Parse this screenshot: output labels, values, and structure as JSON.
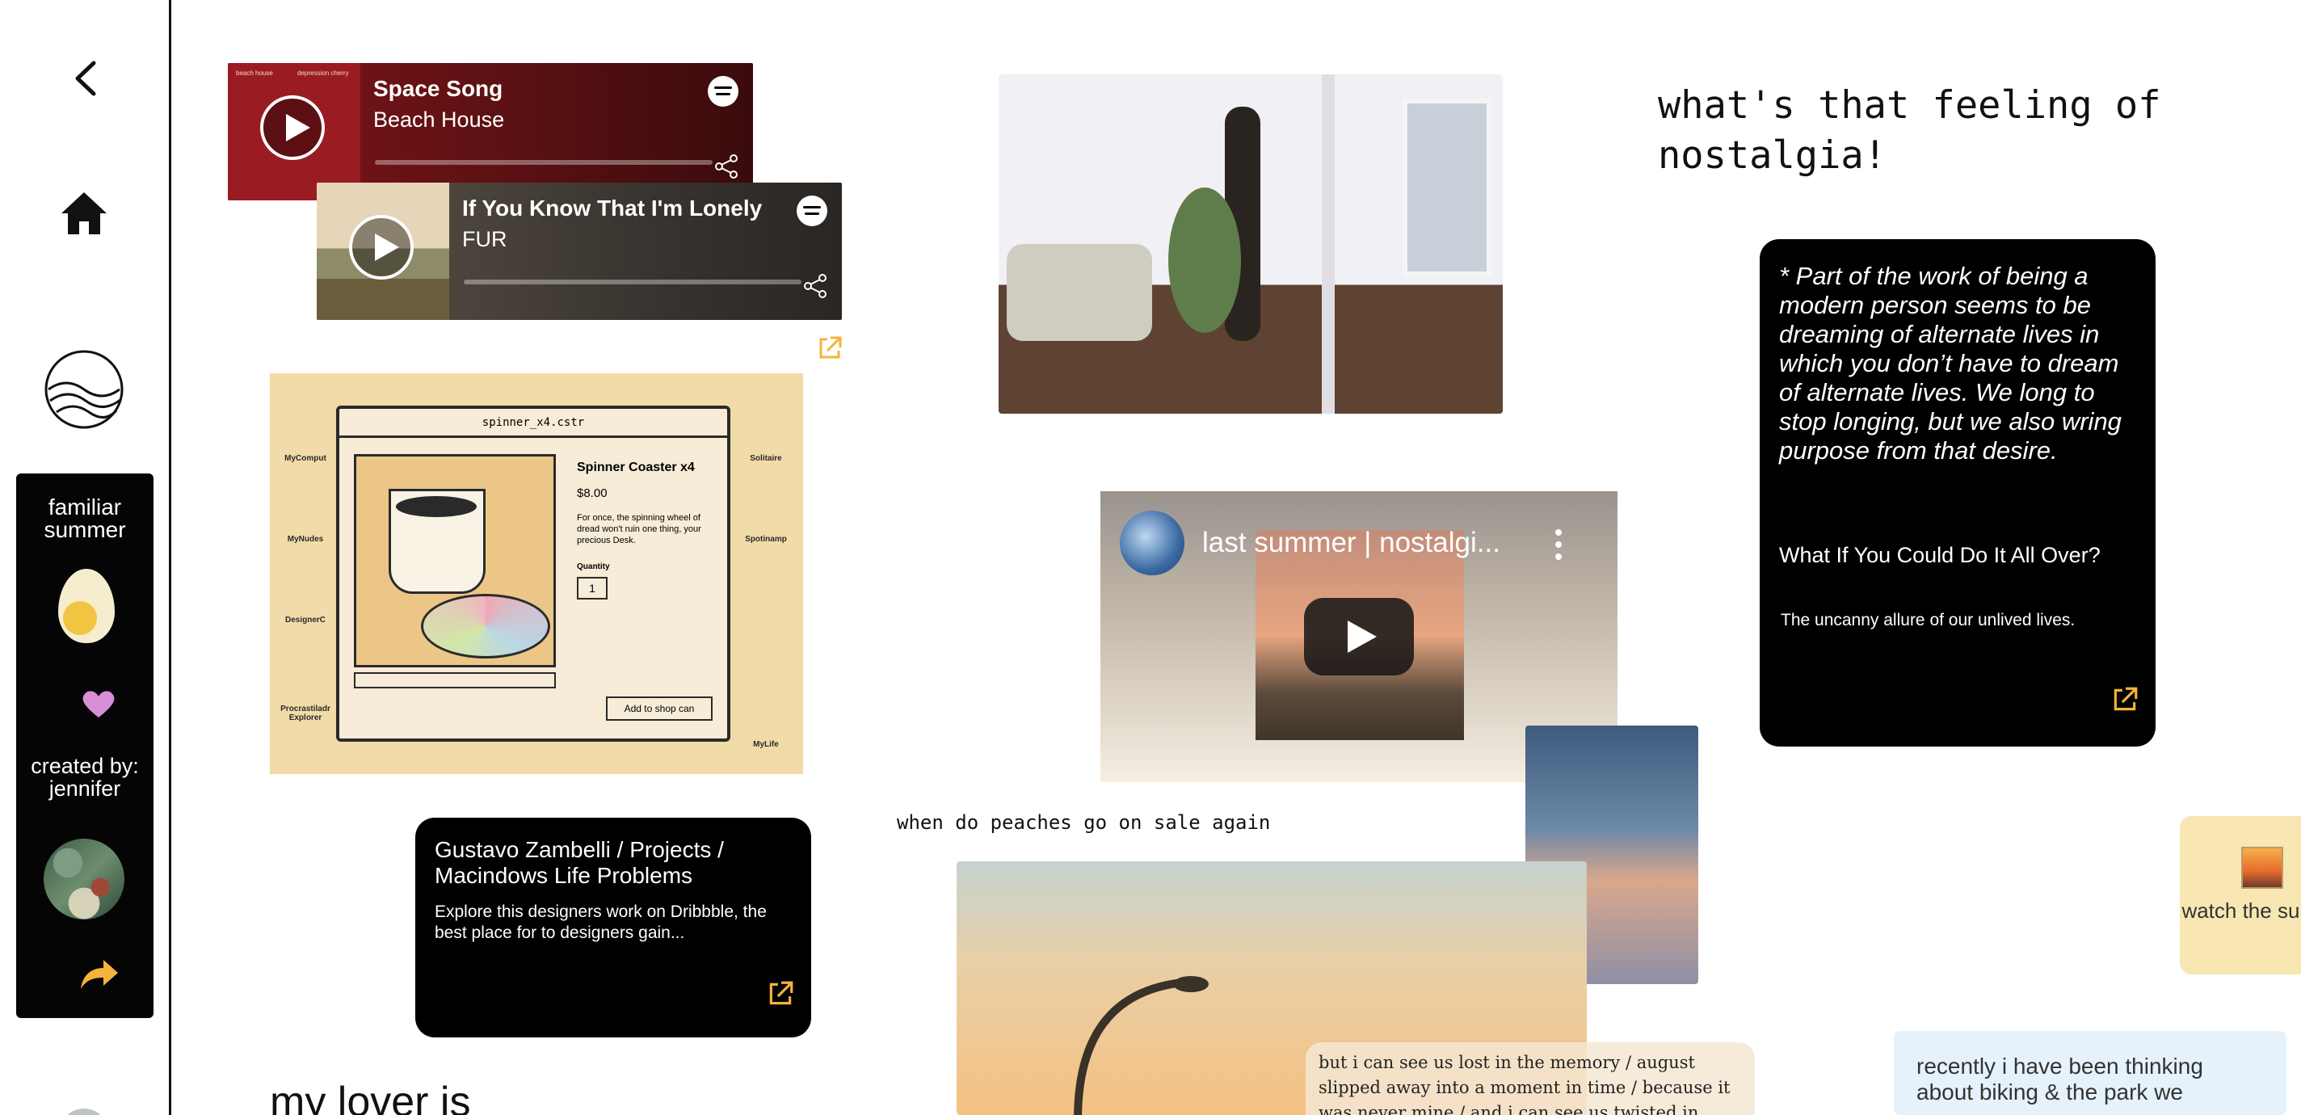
{
  "sidebar": {
    "board_title": "familiar summer",
    "created_label": "created by: jennifer"
  },
  "spotify": [
    {
      "track": "Space Song",
      "artist": "Beach House",
      "art_caption_left": "beach house",
      "art_caption_right": "depression cherry"
    },
    {
      "track": "If You Know That I'm Lonely",
      "artist": "FUR"
    }
  ],
  "collage": {
    "window_title": "spinner_x4.cstr",
    "product_title": "Spinner Coaster x4",
    "product_price": "$8.00",
    "product_desc": "For once, the spinning wheel of dread won't ruin one thing, your precious Desk.",
    "quantity_label": "Quantity",
    "quantity_value": "1",
    "add_button": "Add to shop can",
    "desktop_icons": [
      "MyComput",
      "MyNudes",
      "DesignerC",
      "Procrastiladr Explorer",
      "Solitaire",
      "Spotinamp",
      "MyLife"
    ]
  },
  "dribbble_card": {
    "title": "Gustavo Zambelli / Projects / Macindows Life Problems",
    "description": "Explore this designers work on Dribbble, the best place for to designers gain..."
  },
  "heading": "what's that feeling of nostalgia!",
  "quote_card": {
    "quote": "* Part of the work of being a modern person seems to be dreaming of alternate lives in which you don’t have to dream of alternate lives. We long to stop longing, but we also wring purpose from that desire.",
    "article_title": "What If You Could Do It All Over?",
    "article_subtitle": "The uncanny allure of our unlived lives."
  },
  "video": {
    "title": "last summer | nostalgi..."
  },
  "peach_text": "when do peaches go on sale again",
  "lyrics": "but i can see us lost in the memory / august slipped away into a moment in time / because it was never mine / and i can see us twisted in bedsheets / august sipped away like",
  "sunset_note": "watch the sunset",
  "thought_note": "recently i have been thinking about biking & the park we",
  "lover_text": "my lover is",
  "colors": {
    "sidebar_panel": "#050505",
    "heart": "#d98ed8",
    "share_arrow": "#f4b33a",
    "external_link": "#f4b33a",
    "sunset_note_bg": "#f8e7b2",
    "thought_note_bg": "#e6f2fb"
  },
  "icons": [
    "back-chevron-icon",
    "home-icon",
    "wave-logo-icon",
    "heart-icon",
    "share-arrow-icon",
    "external-link-icon",
    "spotify-icon",
    "play-icon",
    "more-dots-icon",
    "youtube-play-icon"
  ]
}
